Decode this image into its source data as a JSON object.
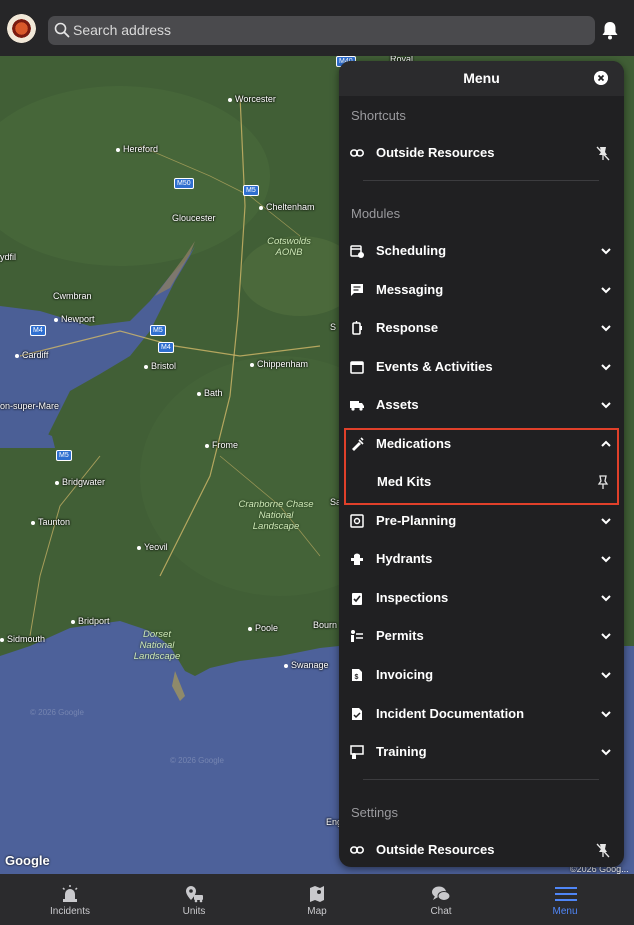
{
  "header": {
    "search_placeholder": "Search address",
    "logo_icon": "fire-department-badge-icon",
    "notifications_icon": "bell-icon"
  },
  "map": {
    "places": [
      "Worcester",
      "Hereford",
      "Cheltenham",
      "Gloucester",
      "Cwmbran",
      "Newport",
      "Cardiff",
      "Bristol",
      "Chippenham",
      "Bath",
      "on-super-Mare",
      "Frome",
      "Bridgwater",
      "Taunton",
      "Yeovil",
      "Bridport",
      "Sidmouth",
      "Poole",
      "Swanage",
      "Bourn",
      "ydfil",
      "Royal",
      "S",
      "Sa",
      "Eng"
    ],
    "areas": {
      "cotswolds": "Cotswolds AONB",
      "cranborne": "Cranborne Chase National Landscape",
      "dorset": "Dorset National Landscape"
    },
    "roads": [
      "M50",
      "M5",
      "M4",
      "M5",
      "M4",
      "M5",
      "M40"
    ],
    "brand": "Google",
    "copyright": "©2026 Goog..."
  },
  "menu": {
    "title": "Menu",
    "close_icon": "close-icon",
    "shortcuts_label": "Shortcuts",
    "modules_label": "Modules",
    "settings_label": "Settings",
    "shortcuts": [
      {
        "label": "Outside Resources",
        "icon": "link-icon",
        "pinned": true
      }
    ],
    "modules": [
      {
        "label": "Scheduling",
        "icon": "calendar-clock-icon",
        "expanded": false
      },
      {
        "label": "Messaging",
        "icon": "message-icon",
        "expanded": false
      },
      {
        "label": "Response",
        "icon": "radio-icon",
        "expanded": false
      },
      {
        "label": "Events & Activities",
        "icon": "calendar-icon",
        "expanded": false
      },
      {
        "label": "Assets",
        "icon": "truck-icon",
        "expanded": false
      },
      {
        "label": "Medications",
        "icon": "syringe-icon",
        "expanded": true,
        "children": [
          {
            "label": "Med Kits",
            "pinned": false
          }
        ]
      },
      {
        "label": "Pre-Planning",
        "icon": "blueprint-icon",
        "expanded": false
      },
      {
        "label": "Hydrants",
        "icon": "hydrant-icon",
        "expanded": false
      },
      {
        "label": "Inspections",
        "icon": "clipboard-check-icon",
        "expanded": false
      },
      {
        "label": "Permits",
        "icon": "permit-icon",
        "expanded": false
      },
      {
        "label": "Invoicing",
        "icon": "invoice-icon",
        "expanded": false
      },
      {
        "label": "Incident Documentation",
        "icon": "document-icon",
        "expanded": false
      },
      {
        "label": "Training",
        "icon": "training-icon",
        "expanded": false
      }
    ],
    "settings": [
      {
        "label": "Outside Resources",
        "icon": "link-icon",
        "pinned": true
      }
    ]
  },
  "tabs": [
    {
      "label": "Incidents",
      "icon": "siren-icon",
      "active": false
    },
    {
      "label": "Units",
      "icon": "units-icon",
      "active": false
    },
    {
      "label": "Map",
      "icon": "map-icon",
      "active": false
    },
    {
      "label": "Chat",
      "icon": "chat-icon",
      "active": false
    },
    {
      "label": "Menu",
      "icon": "hamburger-icon",
      "active": true
    }
  ],
  "colors": {
    "accent": "#4f86f7",
    "highlight_border": "#e0402a",
    "panel": "#202022"
  }
}
